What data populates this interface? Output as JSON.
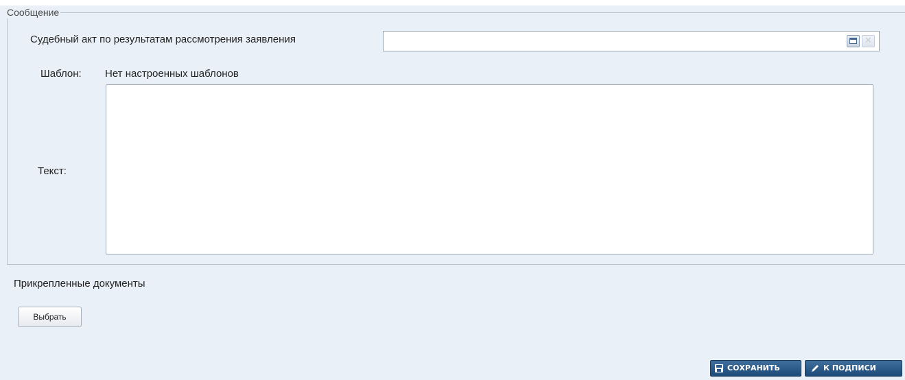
{
  "message_section": {
    "legend": "Сообщение",
    "court_act_label": "Судебный акт по результатам рассмотрения заявления",
    "court_act_value": "",
    "template_label": "Шаблон:",
    "template_value": "Нет настроенных шаблонов",
    "text_label": "Текст:",
    "text_value": ""
  },
  "attachments": {
    "title": "Прикрепленные документы",
    "choose_button": "Выбрать"
  },
  "actions": {
    "save_label": "СОХРАНИТЬ",
    "sign_label": "К ПОДПИСИ"
  },
  "icons": {
    "select_icon": "window-select-icon",
    "clear_icon": "clear-x-icon",
    "save_icon": "floppy-disk-icon",
    "sign_icon": "pen-icon"
  },
  "colors": {
    "panel_background": "#eaf0f7",
    "action_button": "#1d4a78"
  }
}
